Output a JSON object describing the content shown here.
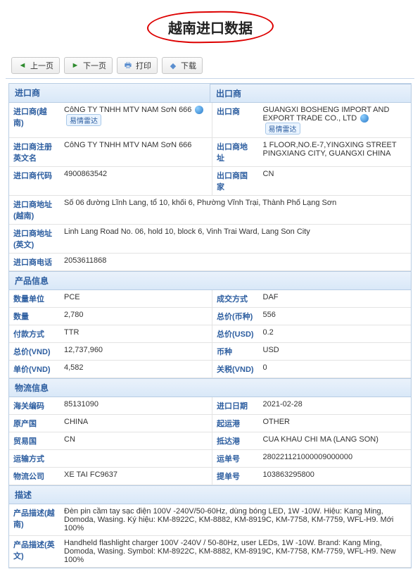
{
  "page": {
    "title": "越南进口数据"
  },
  "toolbar": {
    "prev": "上一页",
    "next": "下一页",
    "print": "打印",
    "download": "下载"
  },
  "sections": {
    "importer": "进口商",
    "exporter": "出口商",
    "product": "产品信息",
    "logistics": "物流信息",
    "desc": "描述"
  },
  "badges": {
    "ship_radar": "易情雷达"
  },
  "importer": {
    "name_vn_lbl": "进口商(越南)",
    "name_vn": "CôNG TY TNHH MTV NAM SơN 666",
    "name_en_lbl": "进口商注册英文名",
    "name_en": "CôNG TY TNHH MTV NAM SơN 666",
    "code_lbl": "进口商代码",
    "code": "4900863542",
    "addr_vn_lbl": "进口商地址(越南)",
    "addr_vn": "Số 06 đường Lĩnh Lang, tổ 10, khối 6, Phường Vĩnh Trại, Thành Phố Lạng Sơn",
    "addr_en_lbl": "进口商地址(英文)",
    "addr_en": "Linh Lang Road No. 06, hold 10, block 6, Vinh Trai Ward, Lang Son City",
    "phone_lbl": "进口商电话",
    "phone": "2053611868"
  },
  "exporter": {
    "name_lbl": "出口商",
    "name": "GUANGXI BOSHENG IMPORT AND EXPORT TRADE CO., LTD",
    "addr_lbl": "出口商地址",
    "addr": "1 FLOOR,NO.E-7,YINGXING STREET PINGXIANG CITY, GUANGXI CHINA",
    "country_lbl": "出口商国家",
    "country": "CN"
  },
  "product": {
    "unit_lbl": "数量单位",
    "unit": "PCE",
    "terms_lbl": "成交方式",
    "terms": "DAF",
    "qty_lbl": "数量",
    "qty": "2,780",
    "total_lbl": "总价(币种)",
    "total": "556",
    "pay_lbl": "付款方式",
    "pay": "TTR",
    "totalusd_lbl": "总价(USD)",
    "totalusd": "0.2",
    "totalvnd_lbl": "总价(VND)",
    "totalvnd": "12,737,960",
    "currency_lbl": "币种",
    "currency": "USD",
    "unitvnd_lbl": "单价(VND)",
    "unitvnd": "4,582",
    "taxvnd_lbl": "关税(VND)",
    "taxvnd": "0"
  },
  "logistics": {
    "hs_lbl": "海关编码",
    "hs": "85131090",
    "date_lbl": "进口日期",
    "date": "2021-02-28",
    "origin_lbl": "原产国",
    "origin": "CHINA",
    "startport_lbl": "起运港",
    "startport": "OTHER",
    "tradectry_lbl": "贸易国",
    "tradectry": "CN",
    "arriveport_lbl": "抵达港",
    "arriveport": "CUA KHAU CHI MA (LANG SON)",
    "transport_lbl": "运输方式",
    "transport": "",
    "billno_lbl": "运单号",
    "billno": "280221121000009000000",
    "carrier_lbl": "物流公司",
    "carrier": "XE TAI FC9637",
    "bill2_lbl": "提单号",
    "bill2": "103863295800"
  },
  "desc": {
    "vn_lbl": "产品描述(越南)",
    "vn": "Đèn pin cầm tay sạc điện 100V -240V/50-60Hz, dùng bóng LED, 1W -10W. Hiệu: Kang Ming, Domoda, Wasing. Ký hiệu: KM-8922C, KM-8882, KM-8919C, KM-7758, KM-7759, WFL-H9. Mới 100%",
    "en_lbl": "产品描述(英文)",
    "en": "Handheld flashlight charger 100V -240V / 50-80Hz, user LEDs, 1W -10W. Brand: Kang Ming, Domoda, Wasing. Symbol: KM-8922C, KM-8882, KM-8919C, KM-7758, KM-7759, WFL-H9. New 100%"
  }
}
